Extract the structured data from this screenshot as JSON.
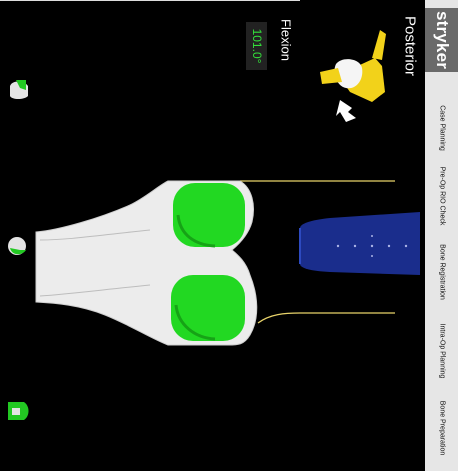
{
  "brand": "stryker",
  "nav": [
    {
      "label": "Case Planning"
    },
    {
      "label": "Pre-Op RIO Check"
    },
    {
      "label": "Bone Registration"
    },
    {
      "label": "Intra-Op Planning"
    },
    {
      "label": "Bone Preparation"
    }
  ],
  "view": {
    "orientation_label": "Posterior",
    "flexion_label": "Flexion",
    "flexion_value": "101.0°"
  },
  "colors": {
    "bone": "#ececec",
    "implant": "#22d822",
    "tibia_tray": "#1a2d8c",
    "outline": "#e8d36a",
    "sidebar": "#e6e6e6",
    "angle_text": "#33e03a",
    "probe": "#f2d21a"
  }
}
